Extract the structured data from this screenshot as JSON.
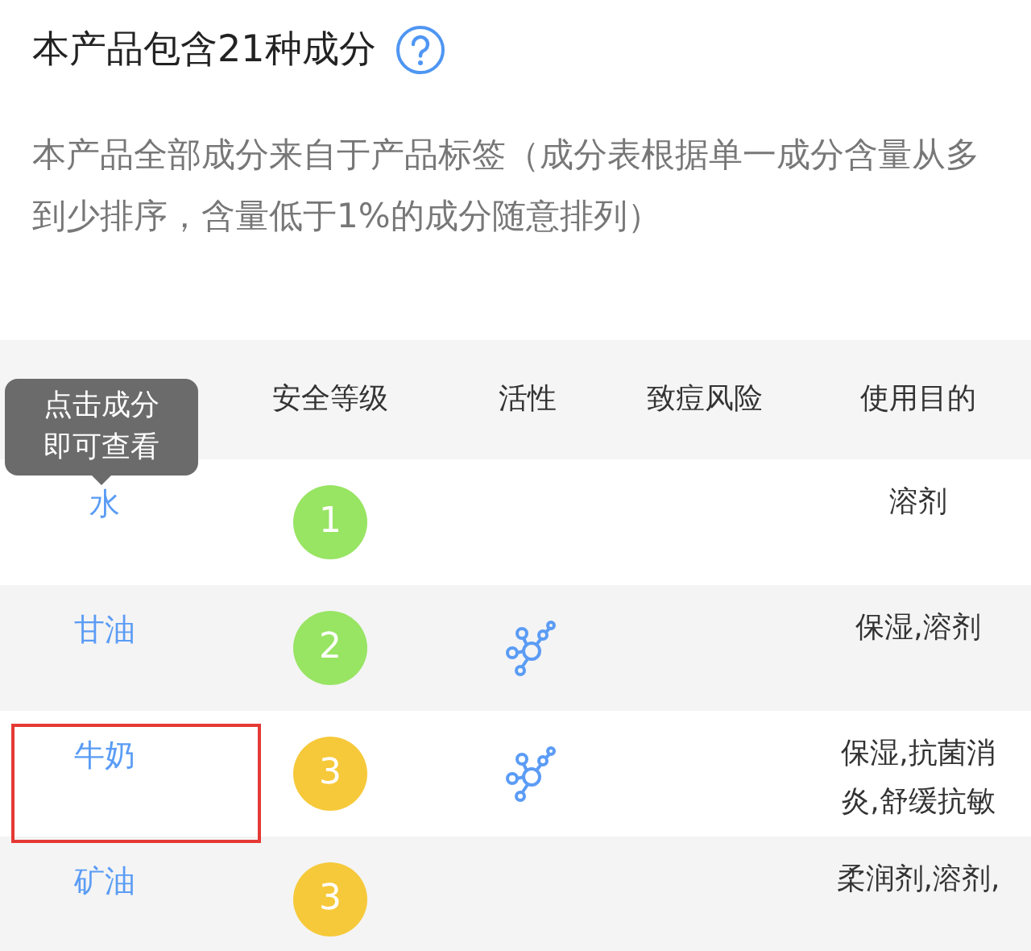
{
  "title": "本产品包含21种成分",
  "description": "本产品全部成分来自于产品标签（成分表根据单一成分含量从多到少排序，含量低于1%的成分随意排列）",
  "table": {
    "columns": [
      "安全等级",
      "活性",
      "致痘风险",
      "使用目的"
    ],
    "tooltip": [
      "点击成分",
      "即可查看"
    ],
    "rows": [
      {
        "name": "水",
        "safety": "1",
        "active": false,
        "purpose": [
          "溶剂"
        ],
        "highlighted": false
      },
      {
        "name": "甘油",
        "safety": "2",
        "active": true,
        "purpose": [
          "保湿,溶剂"
        ],
        "highlighted": false
      },
      {
        "name": "牛奶",
        "safety": "3",
        "active": true,
        "purpose": [
          "保湿,抗菌消",
          "炎,舒缓抗敏"
        ],
        "highlighted": true
      },
      {
        "name": "矿油",
        "safety": "3",
        "active": false,
        "purpose": [
          "柔润剂,溶剂,"
        ],
        "highlighted": false
      }
    ]
  }
}
